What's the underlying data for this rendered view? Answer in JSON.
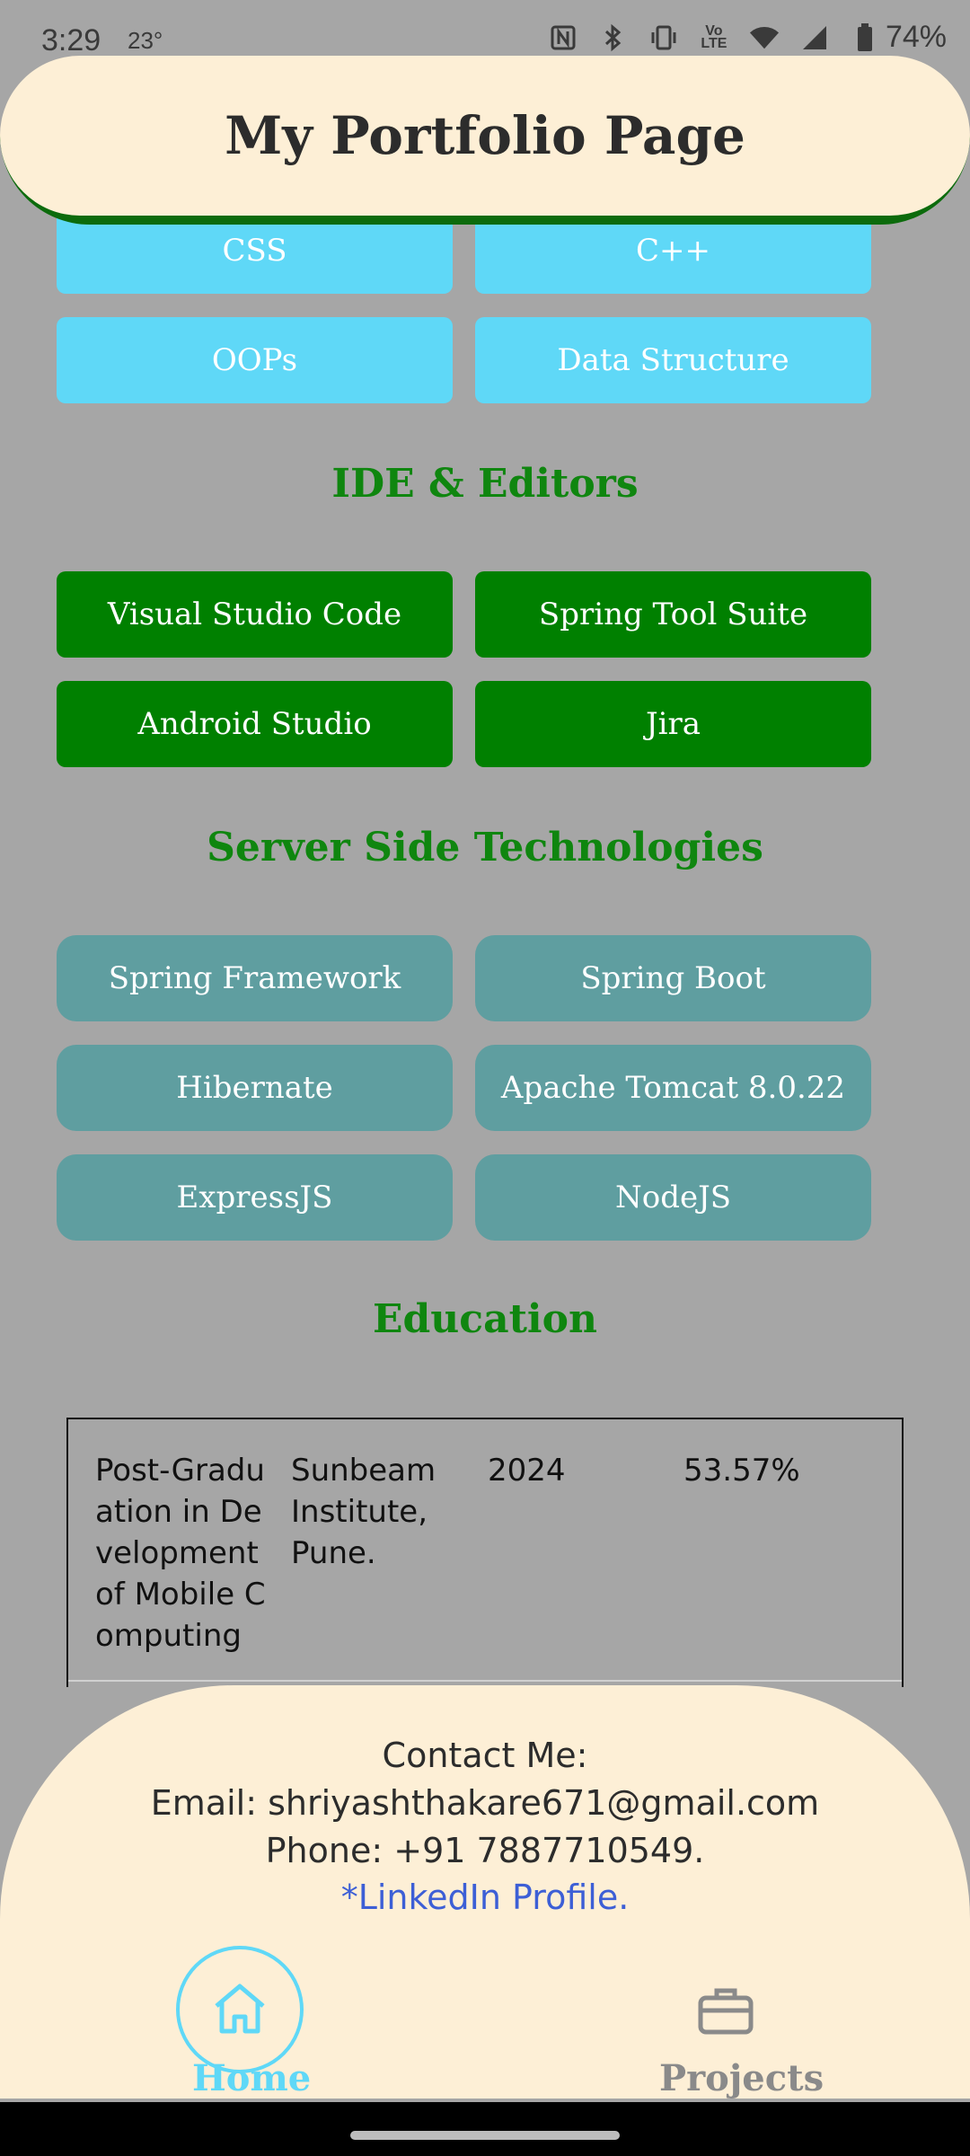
{
  "status": {
    "time": "3:29",
    "temperature": "23°",
    "battery": "74%"
  },
  "header": {
    "title": "My Portfolio Page"
  },
  "skills": [
    "CSS",
    "C++",
    "OOPs",
    "Data Structure"
  ],
  "ide": {
    "title": "IDE & Editors",
    "items": [
      "Visual Studio Code",
      "Spring Tool Suite",
      "Android Studio",
      "Jira"
    ]
  },
  "server": {
    "title": "Server Side Technologies",
    "items": [
      "Spring Framework",
      "Spring Boot",
      "Hibernate",
      "Apache Tomcat 8.0.22",
      "ExpressJS",
      "NodeJS"
    ]
  },
  "education": {
    "title": "Education",
    "rows": [
      {
        "course": "Post-Graduation in Development of Mobile Computing",
        "institute": "Sunbeam Institute, Pune.",
        "year": "2024",
        "score": "53.57%"
      }
    ]
  },
  "contact": {
    "heading": "Contact Me:",
    "email": "Email: shriyashthakare671@gmail.com",
    "phone": "Phone: +91 7887710549.",
    "linkedin": "*LinkedIn Profile."
  },
  "nav": {
    "home": "Home",
    "projects": "Projects"
  },
  "colors": {
    "accent_blue": "#5fd8f7",
    "green": "#008000",
    "teal": "#5f9ea0",
    "cream": "#fdefd6",
    "background": "#a6a6a6"
  }
}
